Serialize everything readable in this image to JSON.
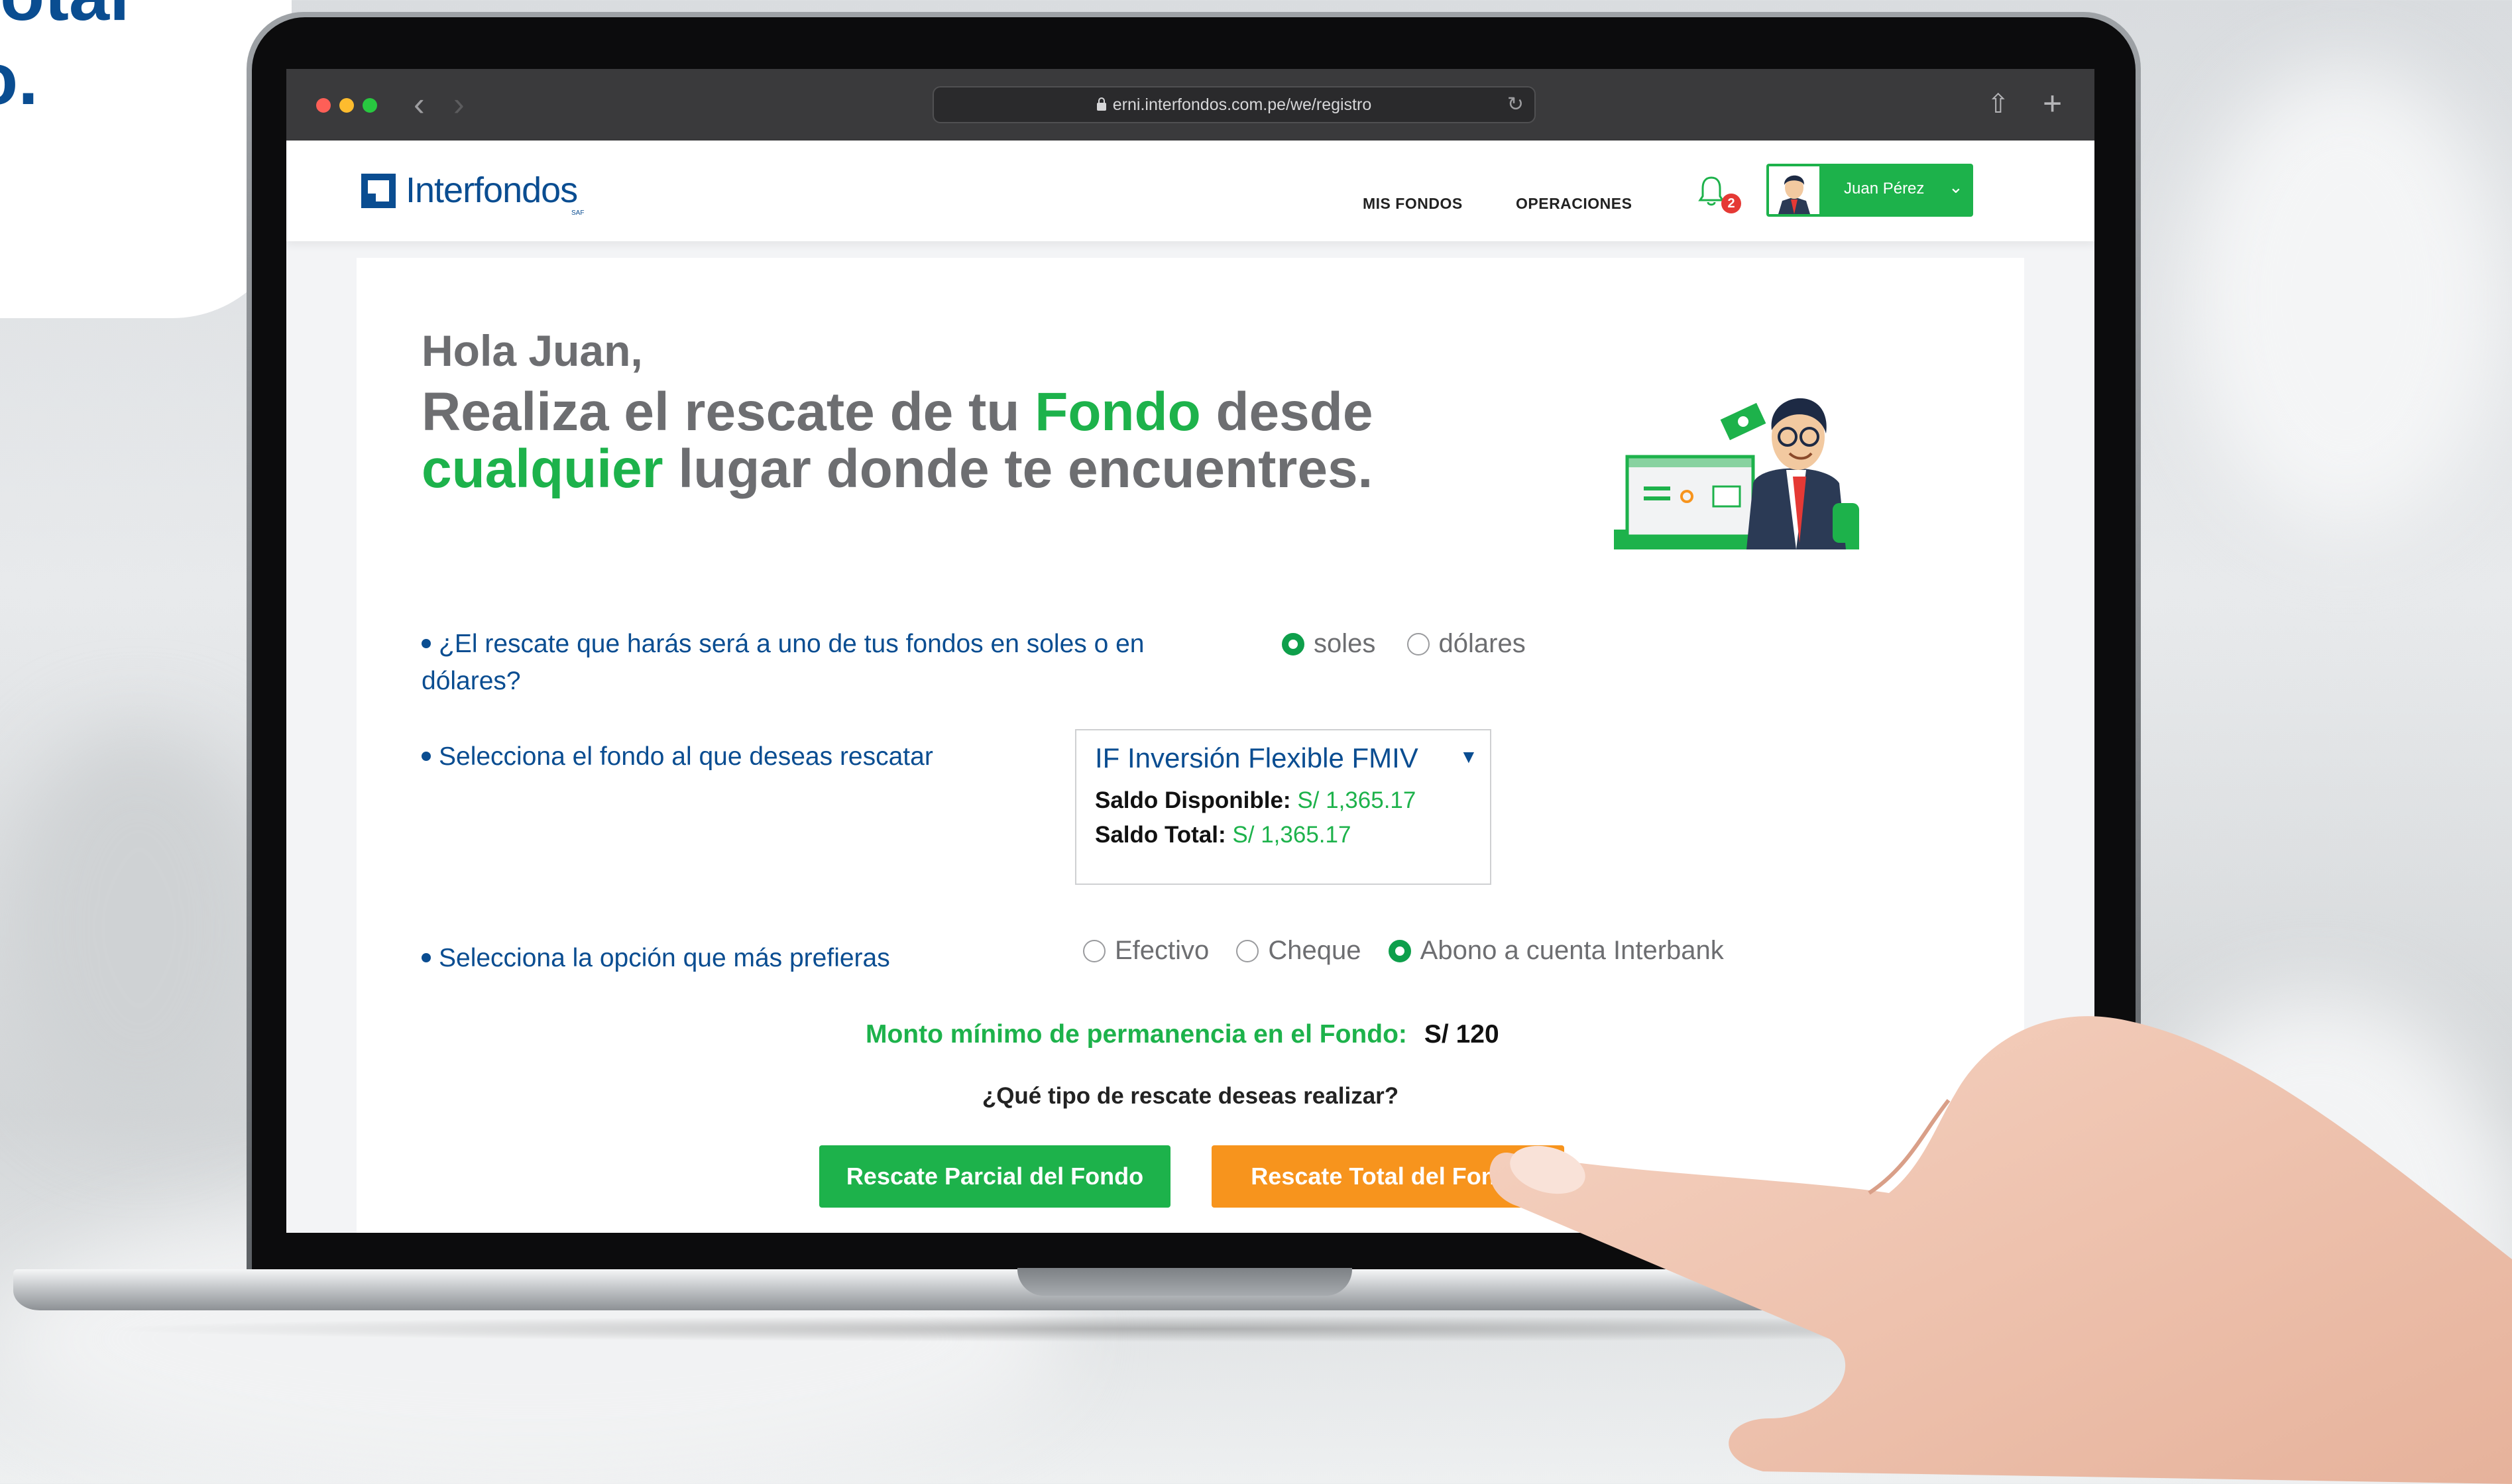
{
  "promo": {
    "heading_line1": "otal",
    "heading_line2": "o."
  },
  "browser": {
    "url": "erni.interfondos.com.pe/we/registro"
  },
  "header": {
    "logo_text": "Interfondos",
    "logo_sub": "SAF",
    "nav": [
      "MIS FONDOS",
      "OPERACIONES"
    ],
    "notification_count": "2",
    "user_name": "Juan Pérez"
  },
  "main": {
    "greeting": "Hola Juan,",
    "headline": {
      "part1": "Realiza el rescate de tu ",
      "highlight1": "Fondo",
      "part2": " desde ",
      "highlight2": "cualquier",
      "part3": " lugar donde te encuentres."
    },
    "currency_question": "¿El rescate que harás será a uno de tus fondos en soles o en dólares?",
    "currency_options": [
      "soles",
      "dólares"
    ],
    "currency_selected": "soles",
    "fund_question": "Selecciona el fondo al que deseas rescatar",
    "fund": {
      "name": "IF Inversión Flexible FMIV",
      "available_label": "Saldo Disponible:",
      "available_value": "S/ 1,365.17",
      "total_label": "Saldo Total:",
      "total_value": "S/ 1,365.17"
    },
    "payment_question": "Selecciona la opción que más prefieras",
    "payment_options": [
      "Efectivo",
      "Cheque",
      "Abono a cuenta Interbank"
    ],
    "payment_selected": "Abono a cuenta Interbank",
    "min_label": "Monto mínimo de permanencia en el Fondo:",
    "min_value": "S/ 120",
    "rescue_question": "¿Qué tipo de rescate deseas realizar?",
    "btn_partial": "Rescate Parcial del Fondo",
    "btn_total": "Rescate Total del Fondo"
  },
  "colors": {
    "brand_blue": "#0a4d91",
    "brand_green": "#1db24b",
    "accent_orange": "#f7941d"
  }
}
